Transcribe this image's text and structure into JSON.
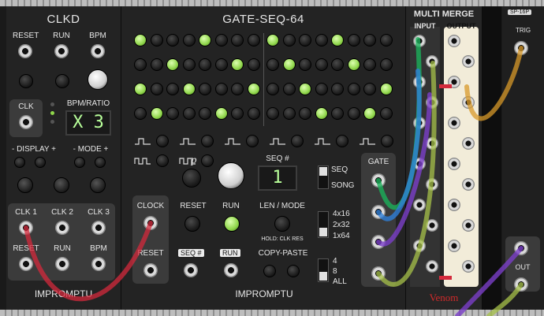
{
  "clkd": {
    "title": "CLKD",
    "top_labels": [
      "RESET",
      "RUN",
      "BPM"
    ],
    "clk_label": "CLK",
    "bpm_ratio_label": "BPM/RATIO",
    "display_value": "X 3",
    "display_label": "- DISPLAY +",
    "mode_label": "- MODE +",
    "out_labels": [
      "CLK 1",
      "CLK 2",
      "CLK 3"
    ],
    "bottom_labels": [
      "RESET",
      "RUN",
      "BPM"
    ],
    "brand": "IMPROMPTU"
  },
  "gateseq": {
    "title": "GATE-SEQ-64",
    "lit_steps": [
      [
        1,
        0,
        0,
        0,
        1,
        0,
        0,
        0,
        1,
        0,
        0,
        0,
        1,
        0,
        0,
        0
      ],
      [
        0,
        0,
        1,
        0,
        0,
        0,
        1,
        0,
        0,
        1,
        0,
        0,
        0,
        1,
        0,
        0
      ],
      [
        1,
        0,
        0,
        1,
        0,
        0,
        0,
        1,
        0,
        0,
        1,
        0,
        0,
        0,
        0,
        1
      ],
      [
        0,
        1,
        0,
        0,
        0,
        1,
        0,
        0,
        0,
        0,
        0,
        1,
        0,
        0,
        1,
        0
      ]
    ],
    "p_label": "p",
    "seq_label": "SEQ #",
    "seq_value": "1",
    "seq_song": [
      "SEQ",
      "SONG"
    ],
    "clock_label": "CLOCK",
    "reset_label": "RESET",
    "reset_btn_label": "RESET",
    "run_btn_label": "RUN",
    "len_mode_label": "LEN / MODE",
    "hold_label": "HOLD: CLK RES",
    "len_options": [
      "4x16",
      "2x32",
      "1x64"
    ],
    "seq_tag": "SEQ #",
    "run_tag": "RUN",
    "copy_paste_label": "COPY-PASTE",
    "count_options": [
      "4",
      "8",
      "ALL"
    ],
    "gate_label": "GATE",
    "brand": "IMPROMPTU"
  },
  "merge": {
    "title": "MULTI MERGE",
    "input_label": "INPUT",
    "output_label": "OUTPUT",
    "brand": "Venom"
  },
  "trig": {
    "header": "SP-16P",
    "trig_label": "TRIG",
    "out_label": "OUT"
  },
  "colors": {
    "step_lit": "#8fd64a",
    "lcd_text": "#b8ff9a",
    "cable_red": "#d42a3c",
    "cable_green": "#1bb05a",
    "cable_purple": "#7a3ec8",
    "cable_blue": "#2f7fd8",
    "cable_olive": "#a7c24a",
    "cable_orange": "#d89a2a"
  }
}
